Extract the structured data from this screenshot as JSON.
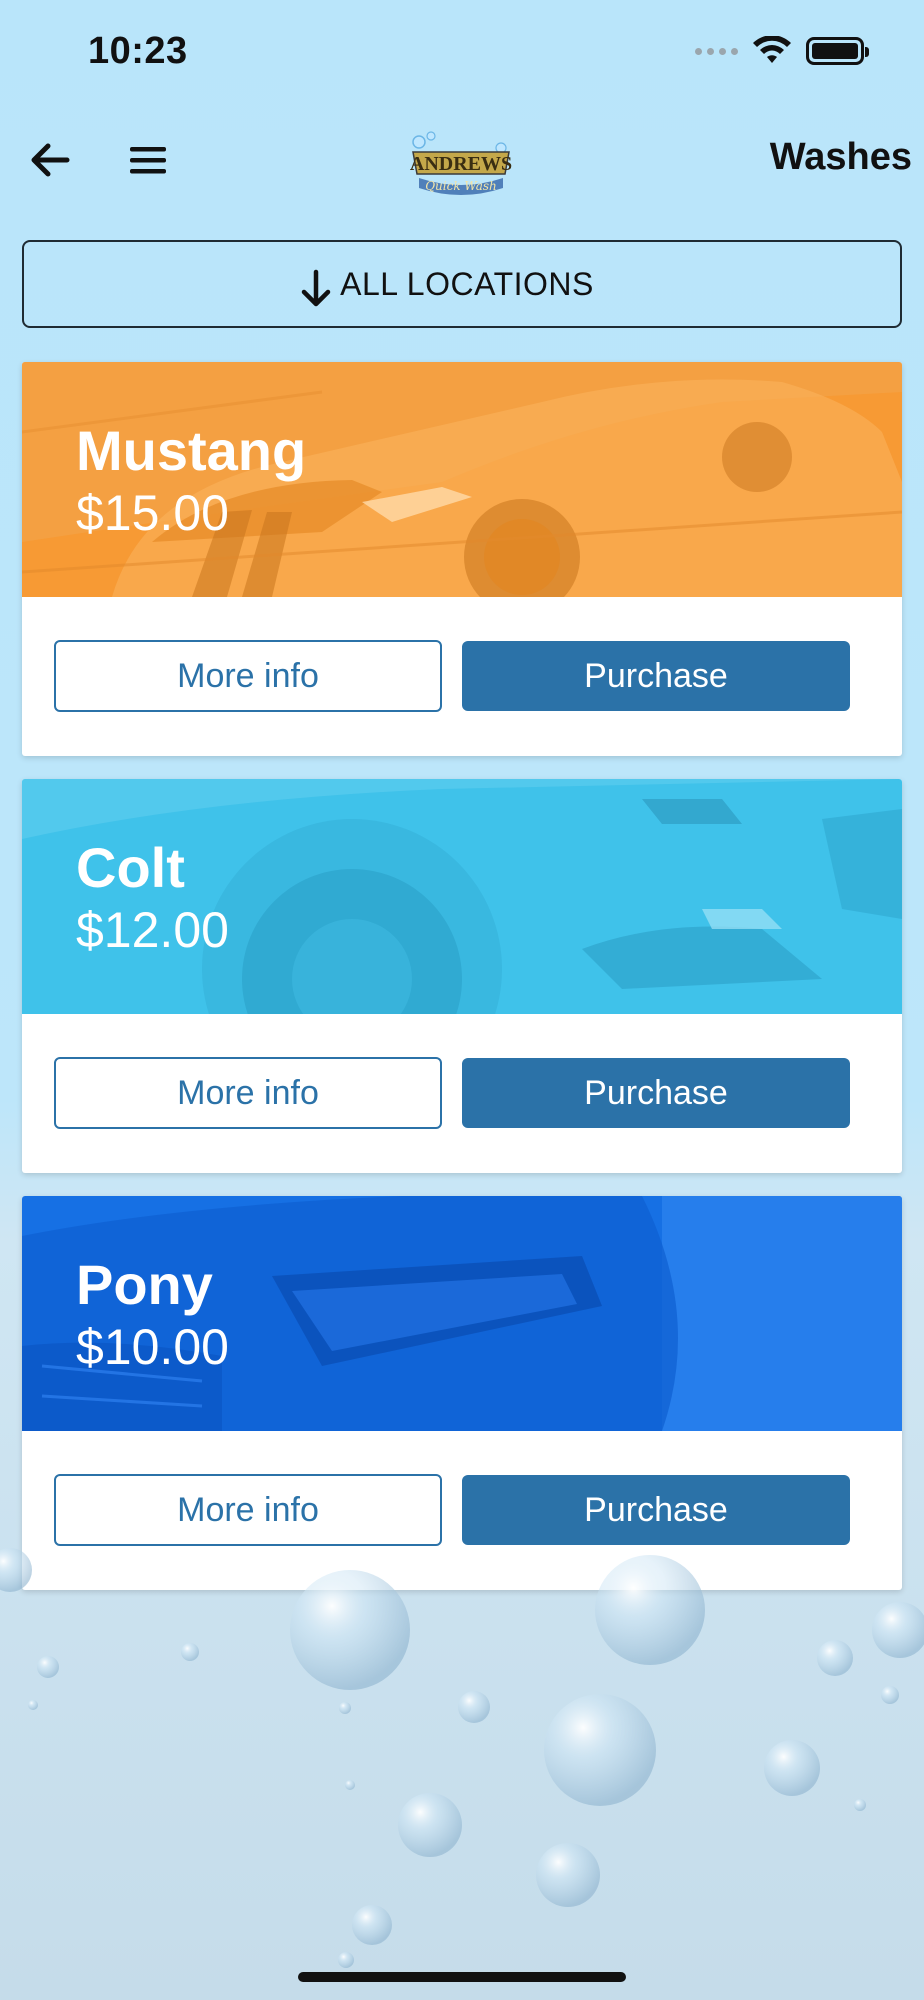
{
  "status_bar": {
    "time": "10:23",
    "icons": [
      "signal-dots-icon",
      "wifi-icon",
      "battery-icon"
    ]
  },
  "nav": {
    "back_icon": "arrow-left-icon",
    "menu_icon": "hamburger-menu-icon",
    "logo_text": "ANDREWS Quick Wash",
    "title": "Washes"
  },
  "location_filter": {
    "icon": "arrow-down-icon",
    "label": "ALL LOCATIONS"
  },
  "washes": [
    {
      "name": "Mustang",
      "price": "$15.00",
      "color": "#f79a34",
      "more_info": "More info",
      "purchase": "Purchase"
    },
    {
      "name": "Colt",
      "price": "$12.00",
      "color": "#3fc2ea",
      "more_info": "More info",
      "purchase": "Purchase"
    },
    {
      "name": "Pony",
      "price": "$10.00",
      "color": "#1670e4",
      "more_info": "More info",
      "purchase": "Purchase"
    }
  ],
  "colors": {
    "accent": "#2b72a8",
    "background": "#b9e5fa"
  }
}
